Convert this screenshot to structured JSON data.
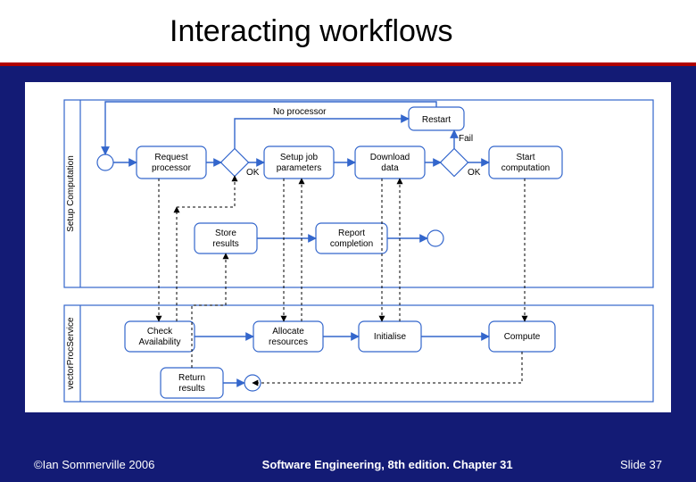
{
  "slide": {
    "title": "Interacting workflows",
    "footer_left": "©Ian Sommerville 2006",
    "footer_center": "Software Engineering, 8th edition. Chapter 31",
    "footer_right": "Slide  37"
  },
  "diagram": {
    "swimlanes": [
      {
        "id": "setup",
        "label": "Setup Computation"
      },
      {
        "id": "vps",
        "label": "vectorProcService"
      }
    ],
    "nodes": {
      "restart": {
        "type": "activity",
        "label": "Restart"
      },
      "req_proc": {
        "type": "activity",
        "label_lines": [
          "Request",
          "processor"
        ]
      },
      "setup_job": {
        "type": "activity",
        "label_lines": [
          "Setup job",
          "parameters"
        ]
      },
      "download": {
        "type": "activity",
        "label_lines": [
          "Download",
          "data"
        ]
      },
      "start_comp": {
        "type": "activity",
        "label_lines": [
          "Start",
          "computation"
        ]
      },
      "store_res": {
        "type": "activity",
        "label_lines": [
          "Store",
          "results"
        ]
      },
      "report": {
        "type": "activity",
        "label_lines": [
          "Report",
          "completion"
        ]
      },
      "check_av": {
        "type": "activity",
        "label_lines": [
          "Check",
          "Availability"
        ]
      },
      "alloc_res": {
        "type": "activity",
        "label_lines": [
          "Allocate",
          "resources"
        ]
      },
      "initialise": {
        "type": "activity",
        "label": "Initialise"
      },
      "compute": {
        "type": "activity",
        "label": "Compute"
      },
      "return_res": {
        "type": "activity",
        "label_lines": [
          "Return",
          "results"
        ]
      },
      "d1": {
        "type": "decision"
      },
      "d2": {
        "type": "decision"
      },
      "start1": {
        "type": "start"
      },
      "end1": {
        "type": "end"
      },
      "end2": {
        "type": "end"
      },
      "end3": {
        "type": "end"
      }
    },
    "edge_labels": {
      "no_processor": "No processor",
      "ok1": "OK",
      "ok2": "OK",
      "fail": "Fail"
    },
    "flows_solid": [
      [
        "start1",
        "req_proc"
      ],
      [
        "req_proc",
        "d1"
      ],
      [
        "d1",
        "setup_job",
        "OK"
      ],
      [
        "d1",
        "restart",
        "No processor"
      ],
      [
        "setup_job",
        "download"
      ],
      [
        "download",
        "d2"
      ],
      [
        "d2",
        "start_comp",
        "OK"
      ],
      [
        "d2",
        "restart",
        "Fail"
      ],
      [
        "restart",
        "start1_loop"
      ],
      [
        "store_res",
        "report"
      ],
      [
        "report",
        "end1"
      ],
      [
        "check_av",
        "alloc_res"
      ],
      [
        "alloc_res",
        "initialise"
      ],
      [
        "initialise",
        "compute"
      ],
      [
        "return_res",
        "end3"
      ]
    ],
    "flows_dashed_interlane": [
      [
        "req_proc",
        "check_av"
      ],
      [
        "check_av",
        "d1_up"
      ],
      [
        "setup_job",
        "alloc_res"
      ],
      [
        "alloc_res",
        "setup_job_up"
      ],
      [
        "download",
        "initialise"
      ],
      [
        "initialise",
        "download_up"
      ],
      [
        "start_comp",
        "compute"
      ],
      [
        "compute",
        "store_res_via_return"
      ]
    ]
  }
}
